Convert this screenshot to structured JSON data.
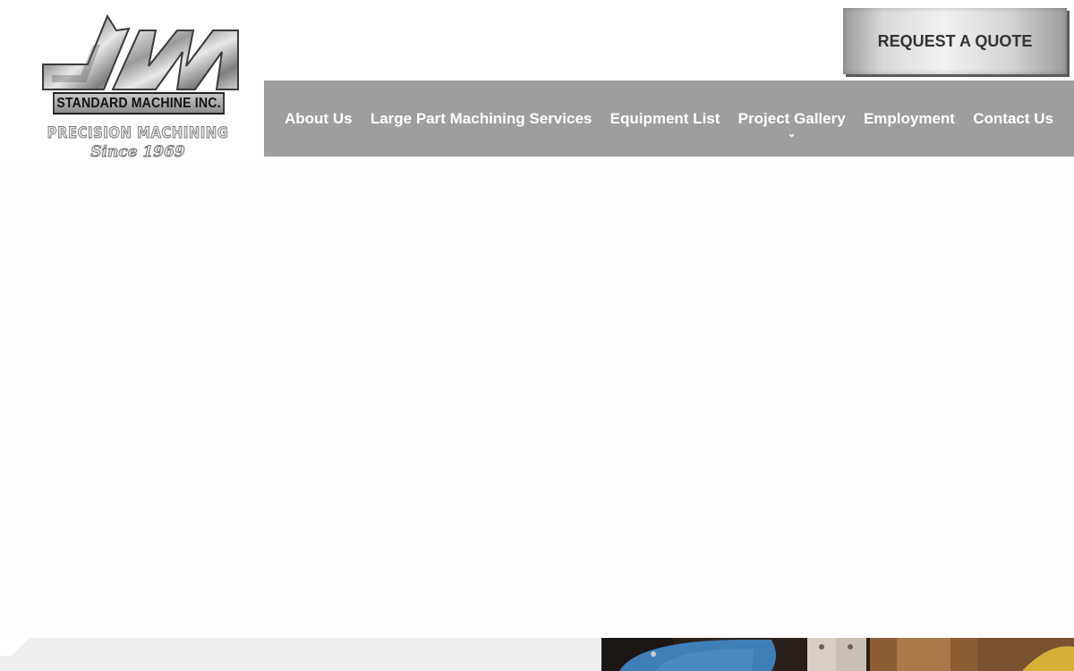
{
  "logo": {
    "company": "STANDARD MACHINE INC.",
    "tagline": "PRECISION MACHINING",
    "since": "Since 1969",
    "icon": "sm-monogram-logo"
  },
  "header": {
    "quote_button": "REQUEST A QUOTE"
  },
  "nav": {
    "items": [
      {
        "label": "About Us"
      },
      {
        "label": "Large Part Machining Services"
      },
      {
        "label": "Equipment List"
      },
      {
        "label": "Project Gallery",
        "has_dropdown": true
      },
      {
        "label": "Employment"
      },
      {
        "label": "Contact Us"
      }
    ],
    "dropdown_icon": "chevron-down-icon"
  },
  "colors": {
    "nav_background": "#9e9e9e",
    "nav_text": "#ffffff",
    "button_text": "#333333",
    "bottom_strip": "#eeeeef",
    "photo_accent": "#3f7fb8"
  }
}
